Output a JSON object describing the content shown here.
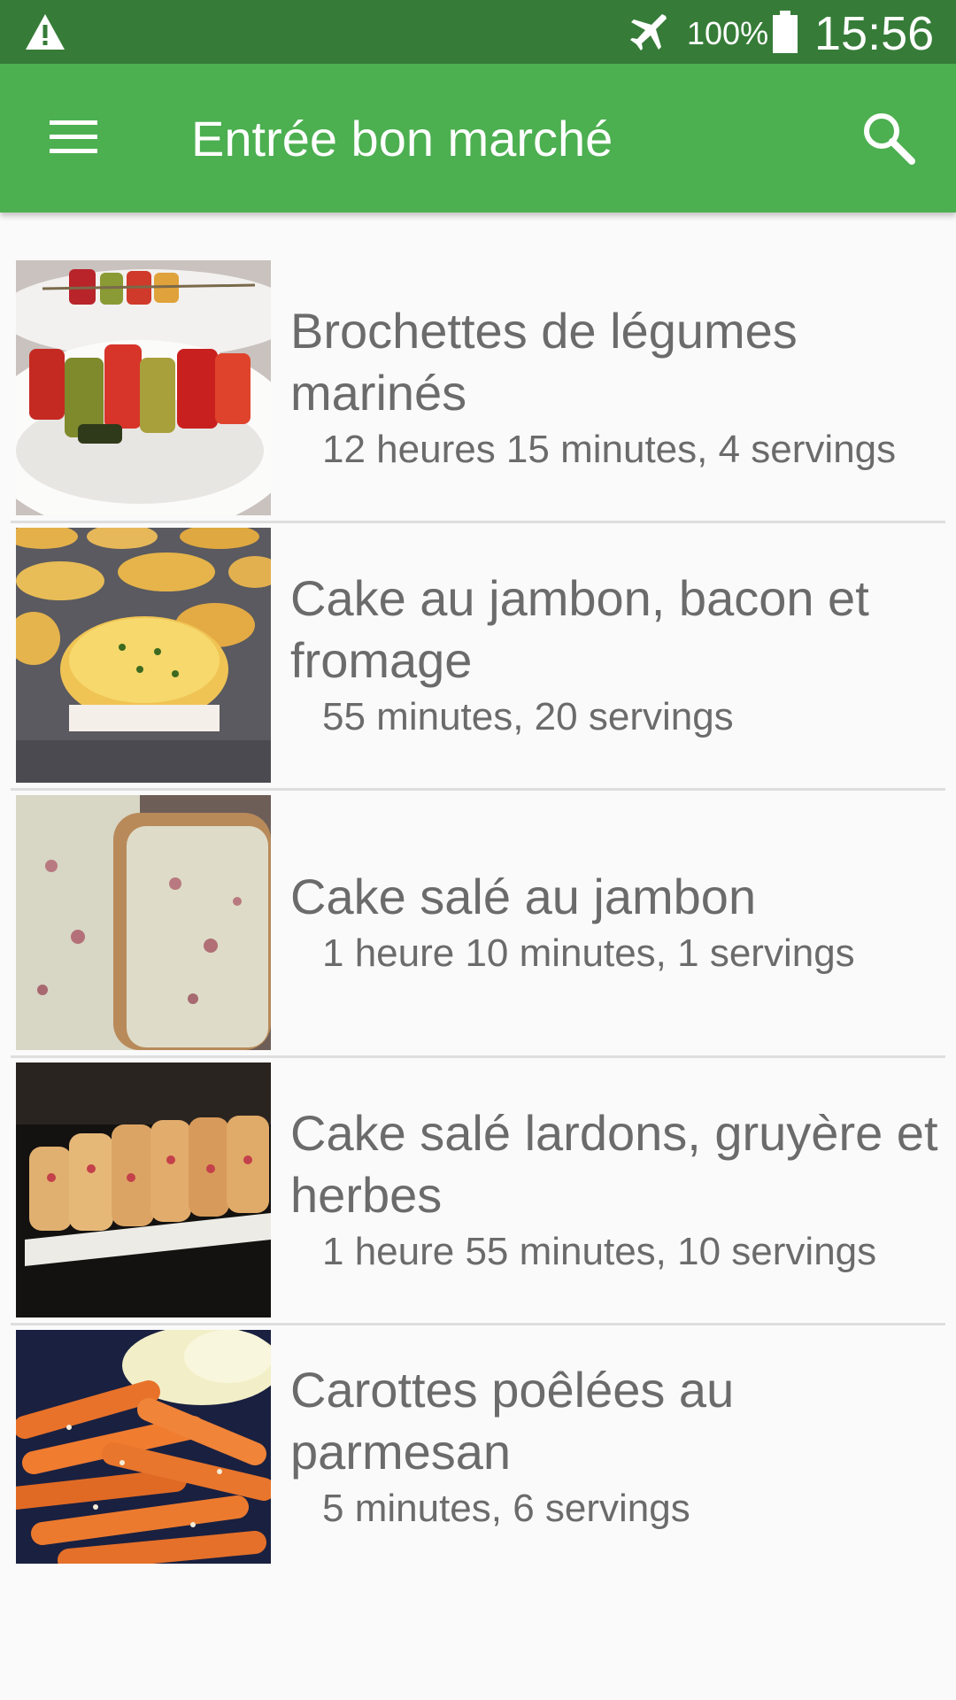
{
  "status_bar": {
    "battery": "100%",
    "time": "15:56",
    "icons": [
      "warning-icon",
      "airplane-mode-icon",
      "battery-icon"
    ]
  },
  "app_bar": {
    "title": "Entrée bon marché",
    "icons": [
      "menu-icon",
      "search-icon"
    ]
  },
  "recipes": [
    {
      "title": "Brochettes de légumes marinés",
      "meta": "12 heures 15 minutes, 4 servings"
    },
    {
      "title": "Cake au jambon, bacon et fromage",
      "meta": "55 minutes, 20 servings"
    },
    {
      "title": "Cake salé au jambon",
      "meta": "1 heure 10 minutes, 1 servings"
    },
    {
      "title": "Cake salé lardons, gruyère et herbes",
      "meta": "1 heure 55 minutes, 10 servings"
    },
    {
      "title": "Carottes poêlées au parmesan",
      "meta": "5 minutes, 6 servings"
    }
  ],
  "colors": {
    "status_bar": "#367c38",
    "app_bar": "#4caf50",
    "background": "#fafafa",
    "text": "#6b6b6b",
    "divider": "#dedede"
  }
}
